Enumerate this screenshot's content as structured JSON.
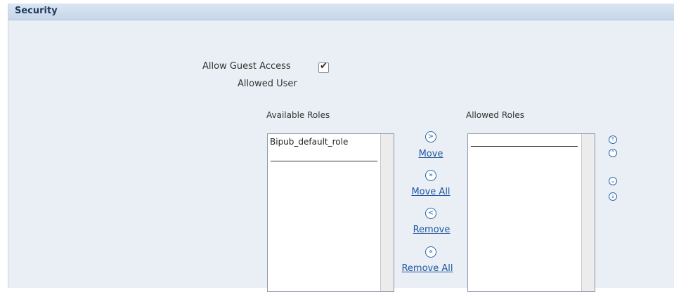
{
  "panel": {
    "title": "Security"
  },
  "form": {
    "guest_access_label": "Allow Guest Access",
    "guest_access_checked": true,
    "allowed_user_label": "Allowed User"
  },
  "shuttle": {
    "available_header": "Available Roles",
    "allowed_header": "Allowed Roles",
    "available_items": [
      "Bipub_default_role"
    ],
    "allowed_items": [],
    "move_label": "Move",
    "move_all_label": "Move All",
    "remove_label": "Remove",
    "remove_all_label": "Remove All",
    "icons": {
      "move": ">",
      "move_all": "»",
      "remove": "<",
      "remove_all": "«",
      "top": "⤒",
      "up": "⌃",
      "down": "⌄",
      "bottom": "⤓"
    }
  },
  "colors": {
    "panel_bg": "#eaeff5",
    "header_bg": "#c6d6e9",
    "link": "#1f56a0"
  }
}
